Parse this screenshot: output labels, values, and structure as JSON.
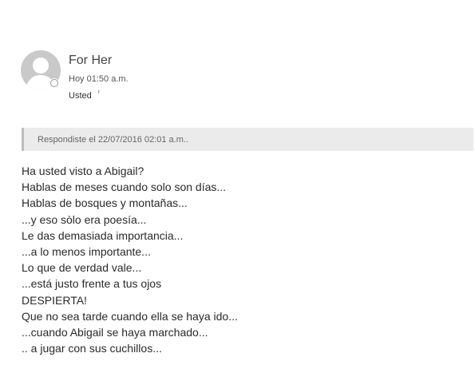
{
  "header": {
    "avatar_icon": "default-person-icon",
    "sender_name": "For Her",
    "sent_time": "Hoy 01:50 a.m.",
    "recipient": "Usted",
    "recipient_expand_icon": "double-chevron-down-icon"
  },
  "reply_banner": {
    "text": "Respondiste el 22/07/2016 02:01 a.m.."
  },
  "body": {
    "lines": [
      "Ha usted visto a Abigail?",
      "Hablas de meses cuando solo son días...",
      "Hablas de bosques y montañas...",
      "...y eso sòlo era poesía...",
      "Le das demasiada importancia...",
      "...a lo menos importante...",
      "Lo que de verdad vale...",
      "...está justo frente a tus ojos",
      "DESPIERTA!",
      "Que no sea tarde cuando ella se haya ido...",
      "...cuando Abigail se haya marchado...",
      ".. a jugar con sus cuchillos..."
    ]
  },
  "colors": {
    "avatar_bg": "#c9c9c9",
    "banner_bg": "#ebebeb",
    "banner_border": "#bdbdbd"
  }
}
